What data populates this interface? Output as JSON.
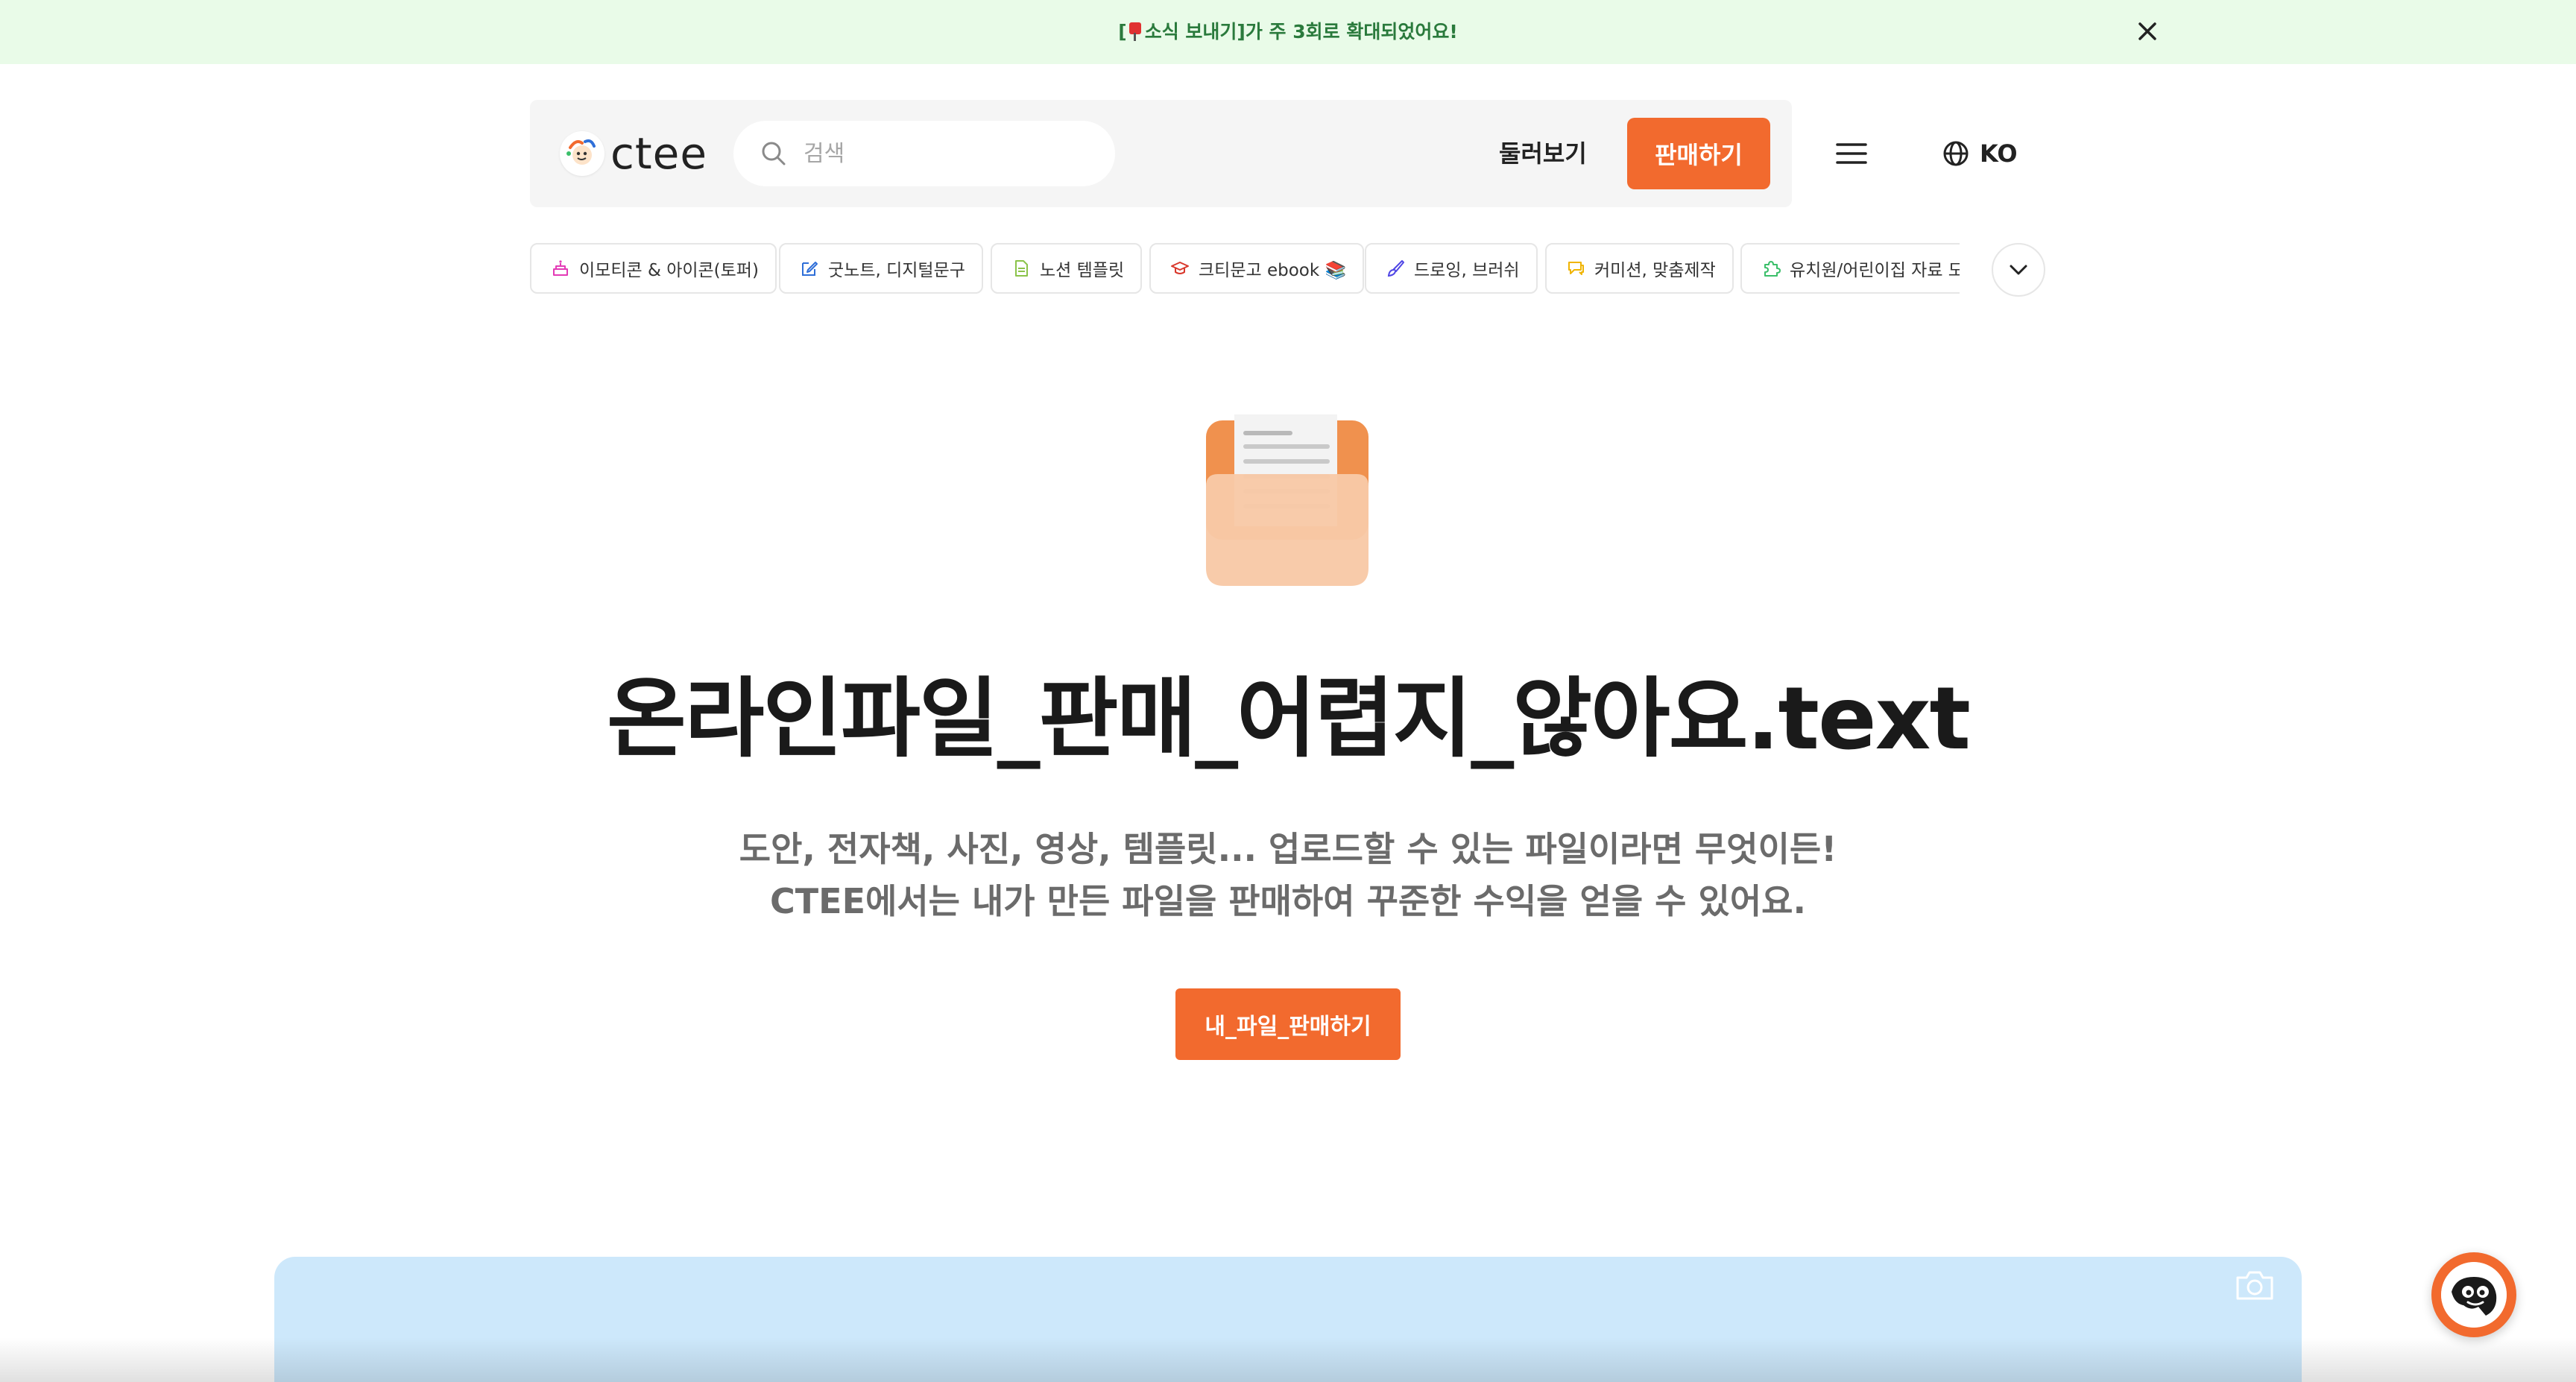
{
  "announcement": {
    "prefix": "[",
    "text": "소식 보내기]가 주 3회로 확대되었어요!",
    "close_label": "×"
  },
  "header": {
    "logo_text": "ctee",
    "search_placeholder": "검색",
    "browse_label": "둘러보기",
    "sell_label": "판매하기",
    "lang_label": "KO"
  },
  "categories": [
    {
      "label": "이모티콘 & 아이콘(토퍼)",
      "icon": "cake-icon",
      "color": "#e33bb6"
    },
    {
      "label": "굿노트, 디지털문구",
      "icon": "pencil-note-icon",
      "color": "#2f6fd8"
    },
    {
      "label": "노션 템플릿",
      "icon": "document-icon",
      "color": "#8bc34a"
    },
    {
      "label": "크티문고 ebook 📚",
      "icon": "graduation-cap-icon",
      "color": "#d9382c"
    },
    {
      "label": "드로잉, 브러쉬",
      "icon": "brush-icon",
      "color": "#4f46e5"
    },
    {
      "label": "커미션, 맞춤제작",
      "icon": "chat-bubble-icon",
      "color": "#f0b400"
    },
    {
      "label": "유치원/어린이집 자료 모음",
      "icon": "puzzle-icon",
      "color": "#3bbf6a"
    }
  ],
  "hero": {
    "title": "온라인파일_판매_어렵지_않아요.text",
    "subtitle_line1": "도안, 전자책, 사진, 영상, 템플릿... 업로드할 수 있는 파일이라면 무엇이든!",
    "subtitle_line2": "CTEE에서는 내가 만든 파일을 판매하여 꾸준한 수익을 얻을 수 있어요.",
    "cta_label": "내_파일_판매하기"
  },
  "colors": {
    "accent": "#f26a2e",
    "announce_bg": "#e9fbe8",
    "announce_text": "#2a7a3c",
    "showcase_bg": "#cde8fb"
  }
}
